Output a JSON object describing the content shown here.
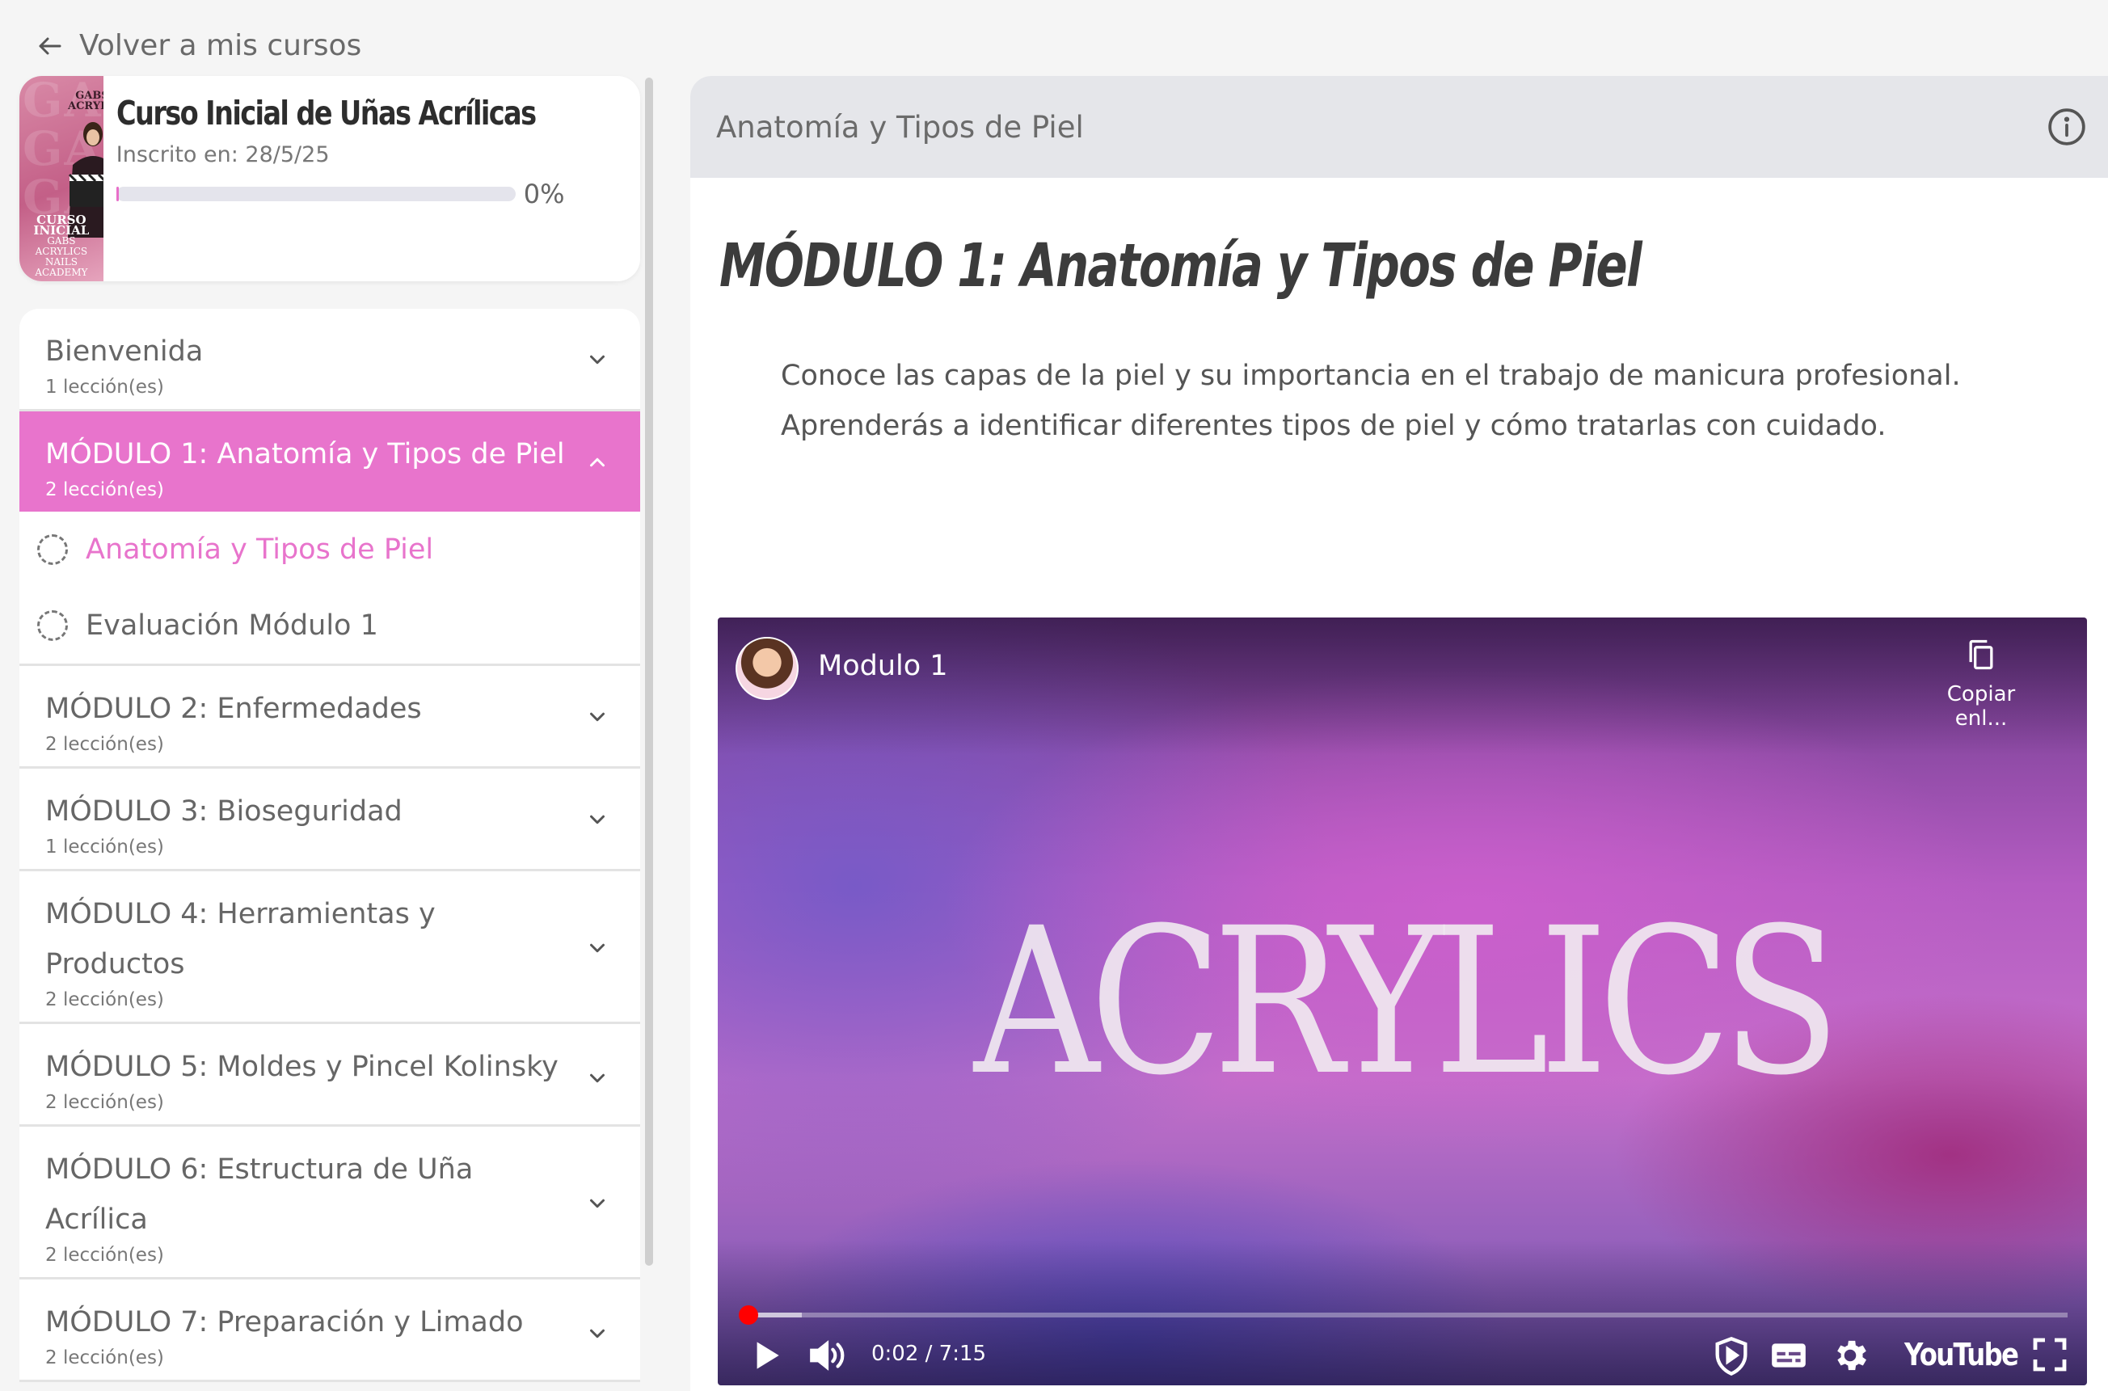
{
  "nav": {
    "back_label": "Volver a mis cursos"
  },
  "course": {
    "title": "Curso Inicial de Uñas Acrílicas",
    "enrolled": "Inscrito en: 28/5/25",
    "progress_label": "0%",
    "progress": 0,
    "thumbnail": {
      "logo": "GABS ACRYLICS",
      "caption_line1": "CURSO INICIAL",
      "caption_line2": "GABS ACRYLICS",
      "caption_line3": "NAILS ACADEMY",
      "bg_word": "GABS"
    }
  },
  "modules": [
    {
      "title": "Bienvenida",
      "count": "1 lección(es)",
      "expanded": false
    },
    {
      "title": "MÓDULO 1: Anatomía y Tipos de Piel",
      "count": "2 lección(es)",
      "expanded": true,
      "lessons": [
        {
          "title": "Anatomía y Tipos de Piel",
          "current": true
        },
        {
          "title": "Evaluación Módulo 1",
          "current": false
        }
      ]
    },
    {
      "title": "MÓDULO 2: Enfermedades",
      "count": "2 lección(es)",
      "expanded": false
    },
    {
      "title": "MÓDULO 3: Bioseguridad",
      "count": "1 lección(es)",
      "expanded": false
    },
    {
      "title": "MÓDULO 4: Herramientas y Productos",
      "count": "2 lección(es)",
      "expanded": false
    },
    {
      "title": "MÓDULO 5: Moldes y Pincel Kolinsky",
      "count": "2 lección(es)",
      "expanded": false
    },
    {
      "title": "MÓDULO 6: Estructura de Uña Acrílica",
      "count": "2 lección(es)",
      "expanded": false
    },
    {
      "title": "MÓDULO 7: Preparación y Limado",
      "count": "2 lección(es)",
      "expanded": false
    }
  ],
  "lesson": {
    "header_title": "Anatomía y Tipos de Piel",
    "module_heading": "MÓDULO 1: Anatomía y Tipos de Piel",
    "description": "Conoce las capas de la piel y su importancia en el trabajo de manicura profesional. Aprenderás a identificar diferentes tipos de piel y cómo tratarlas con cuidado."
  },
  "video": {
    "title": "Modulo 1",
    "copy_label": "Copiar enl...",
    "overlay_text": "ACRYLICS",
    "time": "0:02 / 7:15",
    "played_fraction": 0.005,
    "buffered_fraction": 0.045,
    "platform": "YouTube"
  },
  "colors": {
    "accent": "#e874cc",
    "header_bg": "#e5e6ea",
    "page_bg": "#f5f5f5"
  },
  "icons": {
    "back": "arrow-left-icon",
    "chevron_down": "chevron-down-icon",
    "chevron_up": "chevron-up-icon",
    "info": "info-icon",
    "lesson_status": "dashed-circle-icon",
    "copy": "copy-icon",
    "play": "play-icon",
    "volume": "volume-icon",
    "privacy": "shield-play-icon",
    "subtitles": "subtitles-icon",
    "settings": "gear-icon",
    "fullscreen": "fullscreen-icon"
  }
}
